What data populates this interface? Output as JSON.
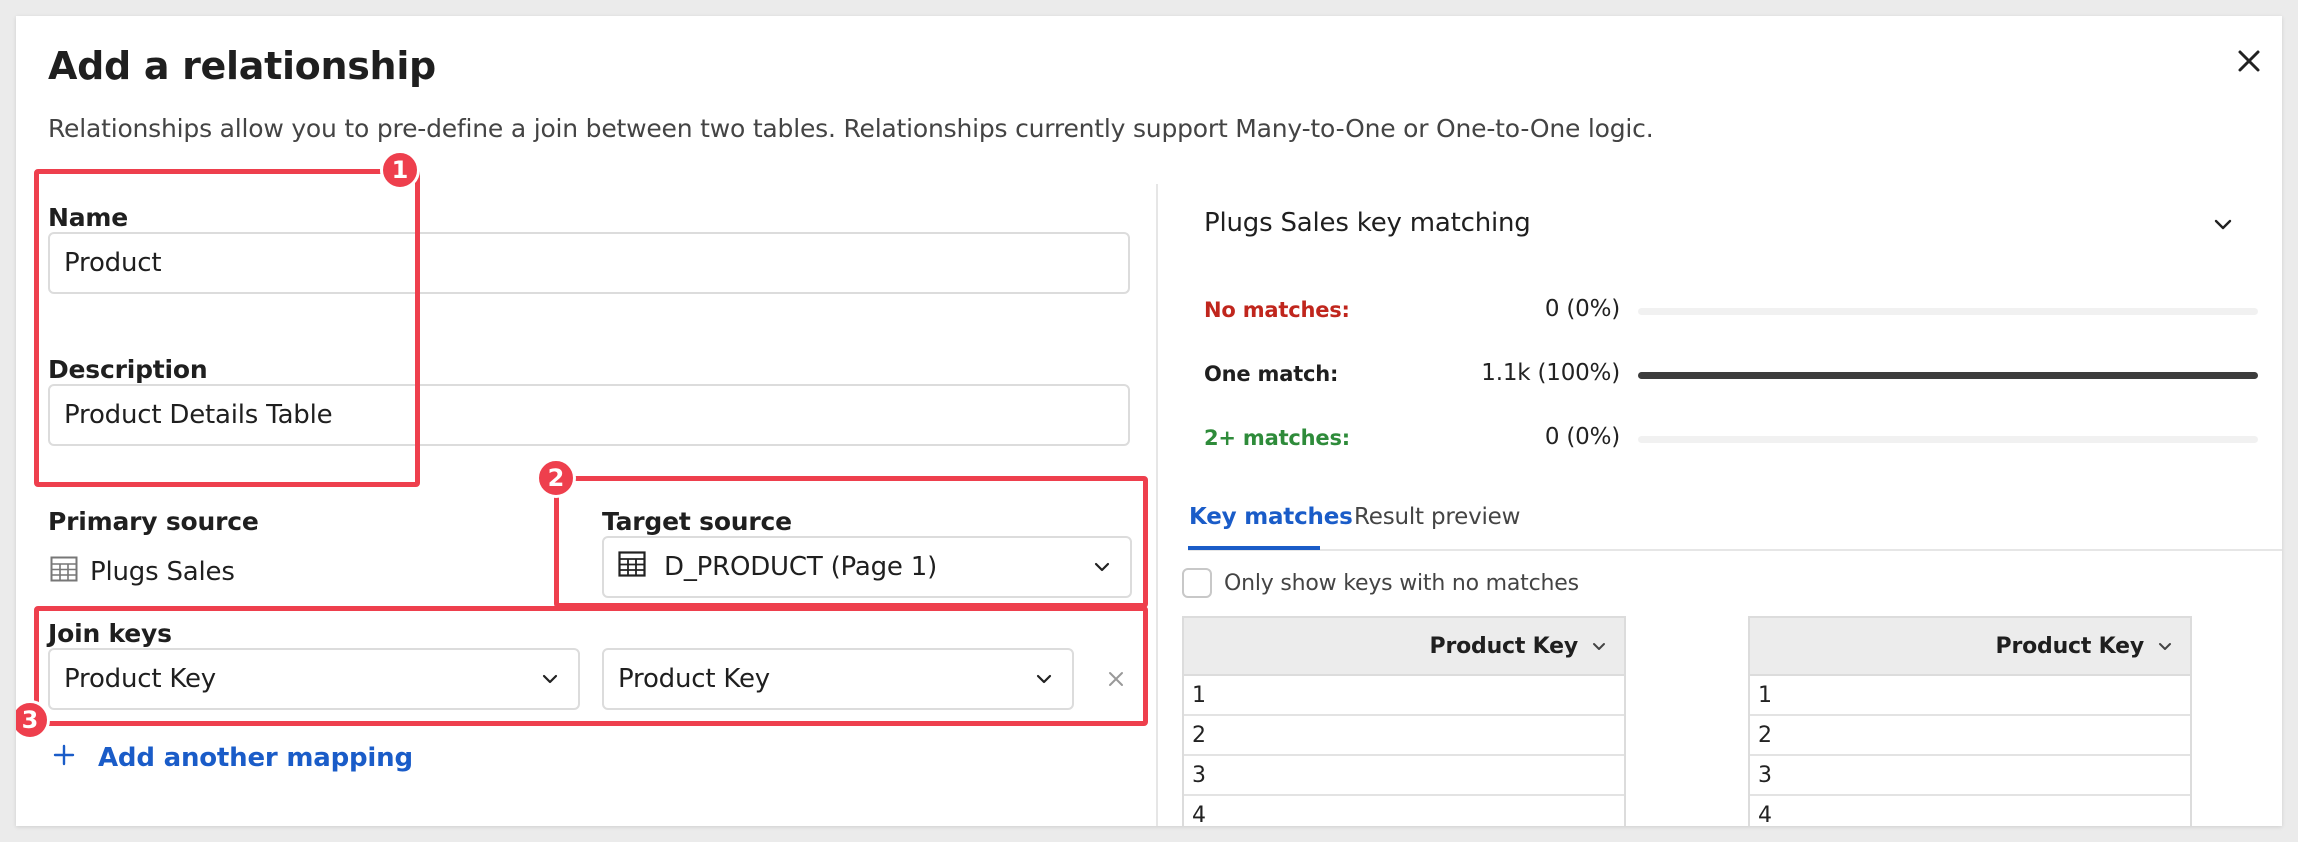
{
  "dialog": {
    "title": "Add a relationship",
    "subtitle": "Relationships allow you to pre-define a join between two tables. Relationships currently support Many-to-One or One-to-One logic."
  },
  "form": {
    "name_label": "Name",
    "name_value": "Product",
    "description_label": "Description",
    "description_value": "Product Details Table",
    "primary_source_label": "Primary source",
    "primary_source_value": "Plugs Sales",
    "target_source_label": "Target source",
    "target_source_value": "D_PRODUCT (Page 1)",
    "join_keys_label": "Join keys",
    "join_key_left": "Product Key",
    "join_key_right": "Product Key",
    "add_mapping_label": "Add another mapping"
  },
  "panel": {
    "title": "Plugs Sales key matching",
    "metrics": [
      {
        "label": "No matches:",
        "value": "0 (0%)",
        "fraction": 0.0,
        "color": "#c0261d"
      },
      {
        "label": "One match:",
        "value": "1.1k (100%)",
        "fraction": 1.0,
        "color": "#1f1f1f"
      },
      {
        "label": "2+ matches:",
        "value": "0 (0%)",
        "fraction": 0.0,
        "color": "#2e8b3a"
      }
    ],
    "tabs": [
      {
        "label": "Key matches",
        "active": true
      },
      {
        "label": "Result preview",
        "active": false
      }
    ],
    "checkbox_label": "Only show keys with no matches",
    "left_table": {
      "header": "Product Key",
      "rows": [
        "1",
        "2",
        "3",
        "4"
      ]
    },
    "right_table": {
      "header": "Product Key",
      "rows": [
        "1",
        "2",
        "3",
        "4"
      ]
    }
  },
  "annotations": [
    "1",
    "2",
    "3"
  ],
  "colors": {
    "accent": "#1a5cc8",
    "annotation": "#ee3f4d"
  }
}
